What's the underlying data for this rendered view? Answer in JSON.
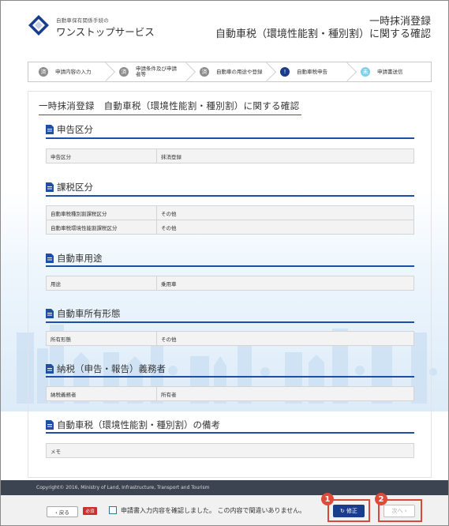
{
  "header": {
    "brand_small": "自動車保有関係手続の",
    "brand_big": "ワンストップサービス",
    "title_line1": "一時抹消登録",
    "title_line2": "自動車税（環境性能割・種別割）に関する確認"
  },
  "steps": [
    {
      "num": "済",
      "label": "申請内容の入力",
      "state": "done"
    },
    {
      "num": "済",
      "label": "申請条件及び申請者等",
      "state": "done"
    },
    {
      "num": "済",
      "label": "自動車の用途や登録",
      "state": "done"
    },
    {
      "num": "!",
      "label": "自動車税申告",
      "state": "current"
    },
    {
      "num": "未",
      "label": "申請書送信",
      "state": "future"
    }
  ],
  "main_title": "一時抹消登録　自動車税（環境性能割・種別割）に関する確認",
  "sections": {
    "s1": {
      "title": "申告区分",
      "rows": [
        {
          "k": "申告区分",
          "v": "抹消登録"
        }
      ]
    },
    "s2": {
      "title": "課税区分",
      "rows": [
        {
          "k": "自動車税種別割課税区分",
          "v": "その他"
        },
        {
          "k": "自動車税環境性能割課税区分",
          "v": "その他"
        }
      ]
    },
    "s3": {
      "title": "自動車用途",
      "rows": [
        {
          "k": "用途",
          "v": "乗用車"
        }
      ]
    },
    "s4": {
      "title": "自動車所有形態",
      "rows": [
        {
          "k": "所有形態",
          "v": "その他"
        }
      ]
    },
    "s5": {
      "title": "納税（申告・報告）義務者",
      "rows": [
        {
          "k": "納税義務者",
          "v": "所有者"
        }
      ]
    },
    "s6": {
      "title": "自動車税（環境性能割・種別割）の備考",
      "rows": [
        {
          "k": "メモ",
          "v": ""
        }
      ]
    }
  },
  "footer": {
    "copyright": "Copyright© 2016, Ministry of Land, Infrastructure, Transport and Tourism",
    "back_label": "‹ 戻る",
    "required_label": "必須",
    "confirm_text": "申請書入力内容を確認しました。 この内容で間違いありません。",
    "fix_label": "↻ 修正",
    "next_label": "次へ ›",
    "badge1": "1",
    "badge2": "2"
  },
  "colors": {
    "accent": "#1a3c8c",
    "highlight": "#d9483b",
    "footer_bg": "#3c4451"
  }
}
